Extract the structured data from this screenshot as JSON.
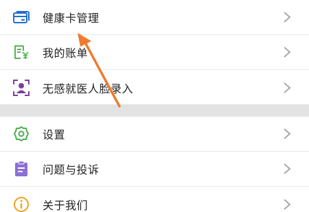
{
  "menu_group_1": {
    "items": [
      {
        "label": "健康卡管理",
        "icon": "card-icon",
        "color": "#1f6fd0"
      },
      {
        "label": "我的账单",
        "icon": "bill-yen-icon",
        "color": "#58b454"
      },
      {
        "label": "无感就医人脸录入",
        "icon": "face-scan-icon",
        "color": "#7a3fa0"
      }
    ]
  },
  "menu_group_2": {
    "items": [
      {
        "label": "设置",
        "icon": "gear-icon",
        "color": "#4caf50"
      },
      {
        "label": "问题与投诉",
        "icon": "clipboard-icon",
        "color": "#8b6fd6"
      },
      {
        "label": "关于我们",
        "icon": "info-icon",
        "color": "#f0a020"
      }
    ]
  },
  "annotation": {
    "icon": "pointer-arrow",
    "color": "#f07b2c"
  },
  "chevron_color": "#a8a8a8"
}
